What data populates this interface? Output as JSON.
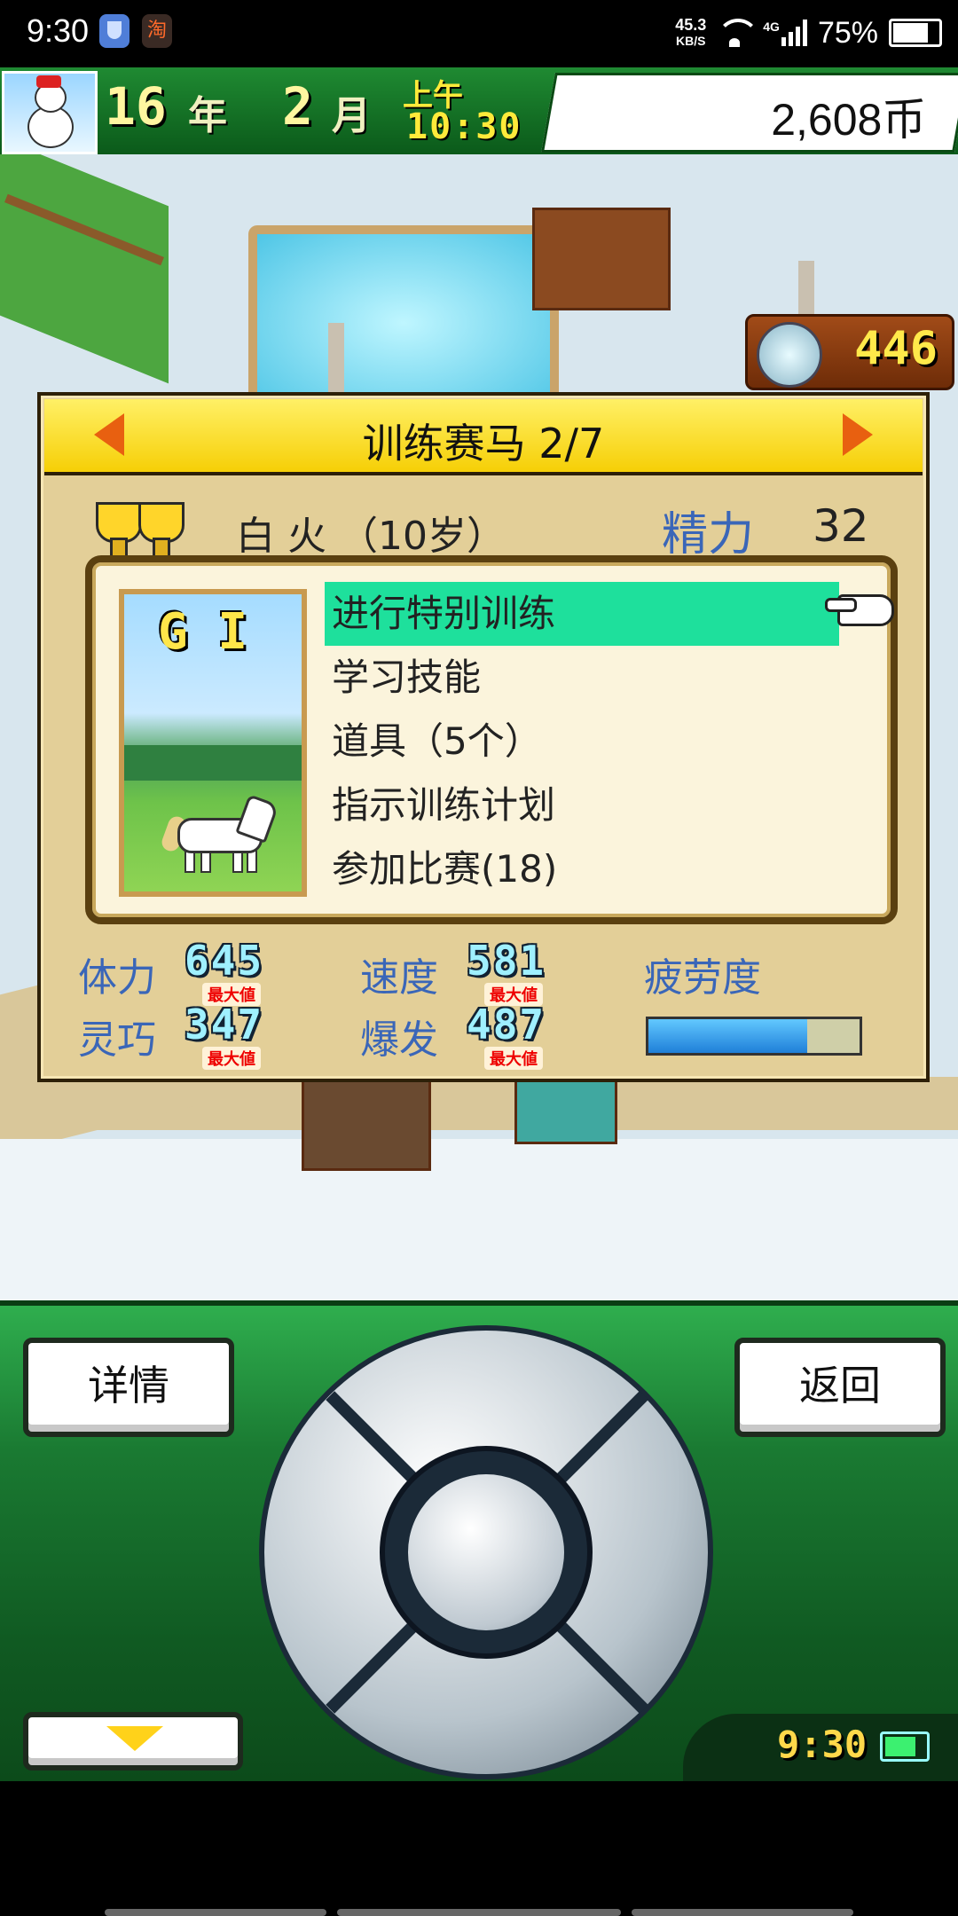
{
  "status_bar": {
    "time": "9:30",
    "app_icon_1": "shield-icon",
    "app_icon_2": "淘",
    "net_speed_value": "45.3",
    "net_speed_unit": "KB/S",
    "network_type": "4G",
    "battery_text": "75%"
  },
  "top_bar": {
    "year_value": "16",
    "year_label": "年",
    "month_value": "2",
    "month_label": "月",
    "ampm": "上午",
    "clock": "10:30",
    "coins": "2,608币"
  },
  "tickets": {
    "value": "446",
    "icon": "horse-medal-icon"
  },
  "dialog": {
    "title": "训练赛马 2/7",
    "horse_name": "白 火 （10岁）",
    "energy_label": "精力",
    "energy_value": "32",
    "grade_badge": "G I",
    "menu_items": [
      {
        "label": "进行特别训练",
        "selected": true
      },
      {
        "label": "学习技能",
        "selected": false
      },
      {
        "label": "道具（5个）",
        "selected": false
      },
      {
        "label": "指示训练计划",
        "selected": false
      },
      {
        "label": "参加比赛(18)",
        "selected": false
      }
    ],
    "stats": {
      "stamina_label": "体力",
      "stamina_value": "645",
      "speed_label": "速度",
      "speed_value": "581",
      "agility_label": "灵巧",
      "agility_value": "347",
      "burst_label": "爆发",
      "burst_value": "487",
      "max_tag": "最大値",
      "fatigue_label": "疲劳度",
      "fatigue_fraction": 0.75
    }
  },
  "controller": {
    "detail_label": "详情",
    "back_label": "返回",
    "clock": "9:30"
  },
  "colors": {
    "menu_highlight": "#1ee09c",
    "stat_label": "#3a66b8",
    "title_bar": "#f6d90a"
  }
}
